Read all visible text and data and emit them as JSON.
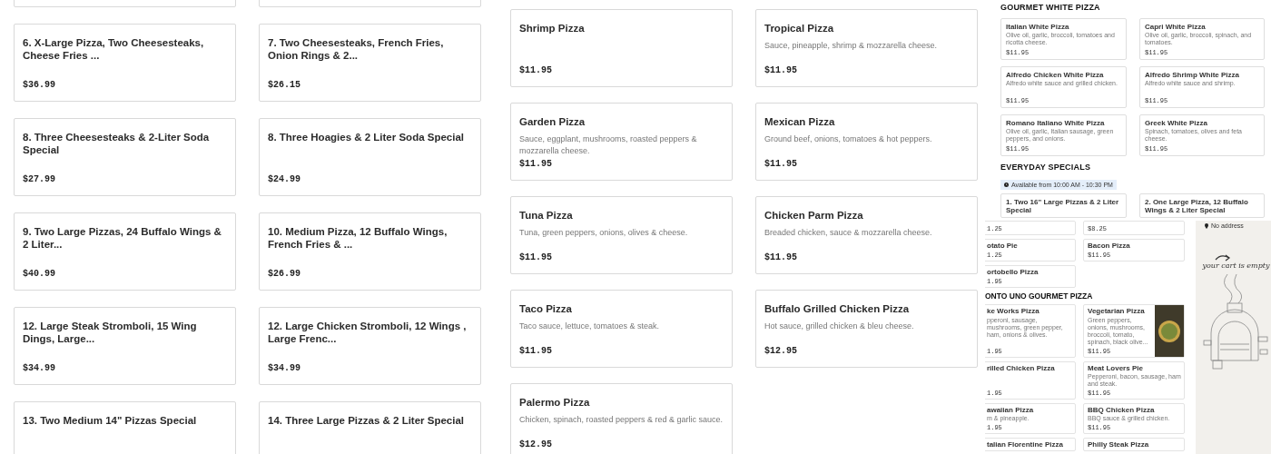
{
  "specials": [
    {
      "title": "6. X-Large Pizza, Two Cheesesteaks, Cheese Fries ...",
      "price": "$36.99"
    },
    {
      "title": "7. Two Cheesesteaks, French Fries, Onion Rings & 2...",
      "price": "$26.15"
    },
    {
      "title": "8. Three Cheesesteaks & 2-Liter Soda Special",
      "price": "$27.99"
    },
    {
      "title": "8. Three Hoagies & 2 Liter Soda Special",
      "price": "$24.99"
    },
    {
      "title": "9. Two Large Pizzas, 24 Buffalo Wings & 2 Liter...",
      "price": "$40.99"
    },
    {
      "title": "10. Medium Pizza, 12 Buffalo Wings, French Fries & ...",
      "price": "$26.99"
    },
    {
      "title": "12. Large Steak Stromboli, 15 Wing Dings, Large...",
      "price": "$34.99"
    },
    {
      "title": "12. Large Chicken Stromboli, 12 Wings , Large Frenc...",
      "price": "$34.99"
    },
    {
      "title": "13. Two Medium 14\" Pizzas Special"
    },
    {
      "title": "14. Three Large Pizzas & 2 Liter Special"
    }
  ],
  "pizzas": [
    {
      "name": "Shrimp Pizza",
      "price": "$11.95"
    },
    {
      "name": "Tropical Pizza",
      "description": "Sauce, pineapple, shrimp & mozzarella cheese.",
      "price": "$11.95"
    },
    {
      "name": "Garden Pizza",
      "description": "Sauce, eggplant, mushrooms, roasted peppers & mozzarella cheese.",
      "price": "$11.95"
    },
    {
      "name": "Mexican Pizza",
      "description": "Ground beef, onions, tomatoes & hot peppers.",
      "price": "$11.95"
    },
    {
      "name": "Tuna Pizza",
      "description": "Tuna, green peppers, onions, olives & cheese.",
      "price": "$11.95"
    },
    {
      "name": "Chicken Parm Pizza",
      "description": "Breaded chicken, sauce & mozzarella cheese.",
      "price": "$11.95"
    },
    {
      "name": "Taco Pizza",
      "description": "Taco sauce, lettuce, tomatoes & steak.",
      "price": "$11.95"
    },
    {
      "name": "Buffalo Grilled Chicken Pizza",
      "description": "Hot sauce, grilled chicken & bleu cheese.",
      "price": "$12.95"
    },
    {
      "name": "Palermo Pizza",
      "description": "Chicken, spinach, roasted peppers & red & garlic sauce.",
      "price": "$12.95"
    }
  ],
  "mini_page": {
    "gourmet_white": {
      "heading": "GOURMET WHITE PIZZA",
      "items": [
        {
          "name": "Italian White Pizza",
          "description": "Olive oil, garlic, broccoli, tomatoes and ricotta cheese.",
          "price": "$11.95"
        },
        {
          "name": "Capri White Pizza",
          "description": "Olive oil, garlic, broccoli, spinach, and tomatoes.",
          "price": "$11.95"
        },
        {
          "name": "Alfredo Chicken White Pizza",
          "description": "Alfredo white sauce and grilled chicken.",
          "price": "$11.95"
        },
        {
          "name": "Alfredo Shrimp White Pizza",
          "description": "Alfredo white sauce and shrimp.",
          "price": "$11.95"
        },
        {
          "name": "Romano Italiano White Pizza",
          "description": "Olive oil, garlic, Italian sausage, green peppers, and onions.",
          "price": "$11.95"
        },
        {
          "name": "Greek White Pizza",
          "description": "Spinach, tomatoes, olives and feta cheese.",
          "price": "$11.95"
        }
      ]
    },
    "everyday_specials": {
      "heading": "EVERYDAY SPECIALS",
      "availability": "Available from 10:00 AM - 10:30 PM",
      "items": [
        {
          "name": "1. Two 16\" Large Pizzas & 2 Liter Special"
        },
        {
          "name": "2. One Large Pizza, 12 Buffalo Wings & 2 Liter Special"
        }
      ]
    },
    "lower_sections": [
      {
        "rows": [
          {
            "left": {
              "price": "1.25"
            },
            "right": {
              "price": "$8.25"
            }
          },
          {
            "left": {
              "name": "otato Pie",
              "price": "1.25"
            },
            "right": {
              "name": "Bacon Pizza",
              "price": "$11.95"
            }
          },
          {
            "left": {
              "name": "ortobello Pizza",
              "price": "1.95"
            }
          }
        ]
      },
      {
        "heading": "ONTO UNO GOURMET PIZZA",
        "rows": [
          {
            "left": {
              "name": "ke Works Pizza",
              "description": "pperoni, sausage, mushrooms, green pepper, ham, onions & olives.",
              "price": "1.95"
            },
            "right": {
              "name": "Vegetarian Pizza",
              "description": "Green peppers, onions, mushrooms, broccoli, tomato, spinach, black olive...",
              "price": "$11.95",
              "photo": true
            }
          },
          {
            "left": {
              "name": "rilled Chicken Pizza",
              "price": "1.95"
            },
            "right": {
              "name": "Meat Lovers Pie",
              "description": "Pepperoni, bacon, sausage, ham and steak.",
              "price": "$11.95"
            }
          },
          {
            "left": {
              "name": "awaiian Pizza",
              "description": "m & pineapple.",
              "price": "1.95"
            },
            "right": {
              "name": "BBQ Chicken Pizza",
              "description": "BBQ sauce & grilled chicken.",
              "price": "$11.95"
            }
          },
          {
            "left": {
              "name": "talian Florentine Pizza"
            },
            "right": {
              "name": "Philly Steak Pizza"
            }
          }
        ]
      }
    ],
    "cart": {
      "address": "No address",
      "message": "your cart is empty"
    }
  }
}
